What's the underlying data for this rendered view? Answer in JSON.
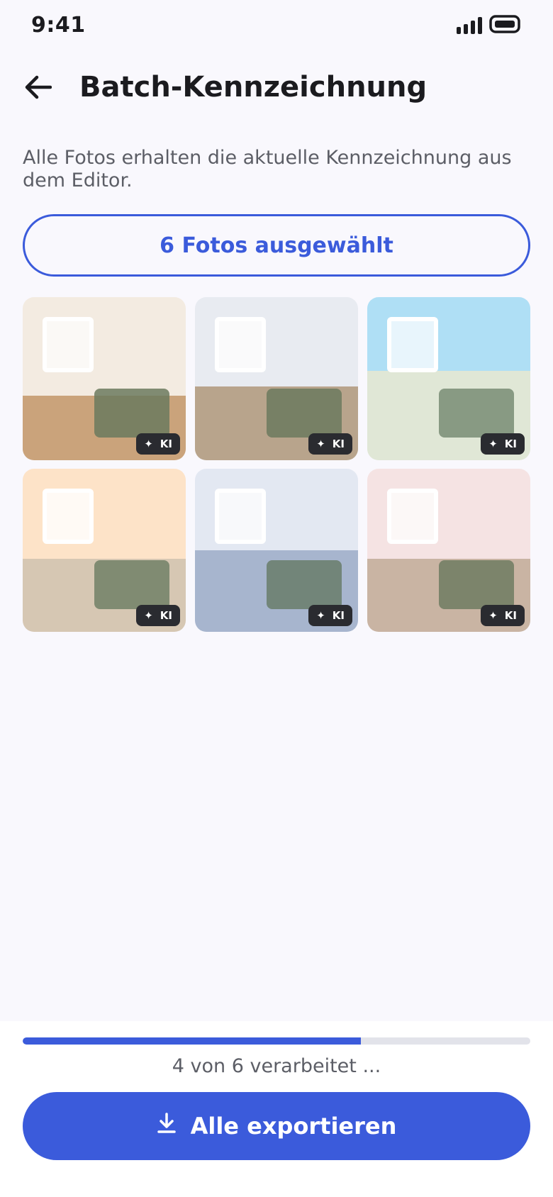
{
  "status_bar": {
    "time": "9:41",
    "icons": [
      "signal-icon",
      "battery-icon"
    ]
  },
  "app_bar": {
    "back_icon": "arrow-back-icon",
    "title": "Batch-Kennzeichnung"
  },
  "description": "Alle Fotos erhalten die aktuelle Kennzeichnung aus dem Editor.",
  "selection_button": {
    "label": "6 Fotos ausgewählt"
  },
  "photos": [
    {
      "badge": "KI",
      "badge_icon": "sparkle-icon",
      "colors": {
        "wall": "#f3ebe1",
        "floor": "#caa37b",
        "window": "#fbf9f6",
        "sofa": "#6b7a5e"
      }
    },
    {
      "badge": "KI",
      "badge_icon": "sparkle-icon",
      "colors": {
        "wall": "#e8ebf1",
        "floor": "#b8a48c",
        "window": "#fafafb",
        "sofa": "#6b7a5e"
      }
    },
    {
      "badge": "KI",
      "badge_icon": "sparkle-icon",
      "colors": {
        "wall": "#afdff5",
        "floor": "#e0e7d6",
        "window": "#e8f5fc",
        "sofa": "#788c74"
      }
    },
    {
      "badge": "KI",
      "badge_icon": "sparkle-icon",
      "colors": {
        "wall": "#fde3c8",
        "floor": "#d6c7b3",
        "window": "#fffaf5",
        "sofa": "#718066"
      }
    },
    {
      "badge": "KI",
      "badge_icon": "sparkle-icon",
      "colors": {
        "wall": "#e3e8f2",
        "floor": "#a7b5ce",
        "window": "#f8f9fb",
        "sofa": "#687c6a"
      }
    },
    {
      "badge": "KI",
      "badge_icon": "sparkle-icon",
      "colors": {
        "wall": "#f5e3e3",
        "floor": "#c9b4a3",
        "window": "#fcf8f7",
        "sofa": "#6f7b62"
      }
    }
  ],
  "progress": {
    "fraction": 0.6667,
    "label": "4 von 6 verarbeitet ..."
  },
  "export_button": {
    "icon": "download-icon",
    "label": "Alle exportieren"
  },
  "colors": {
    "accent": "#3b5bdb",
    "background": "#f9f8fd",
    "text_secondary": "#5c5e66",
    "badge_bg": "#2a2b30"
  }
}
